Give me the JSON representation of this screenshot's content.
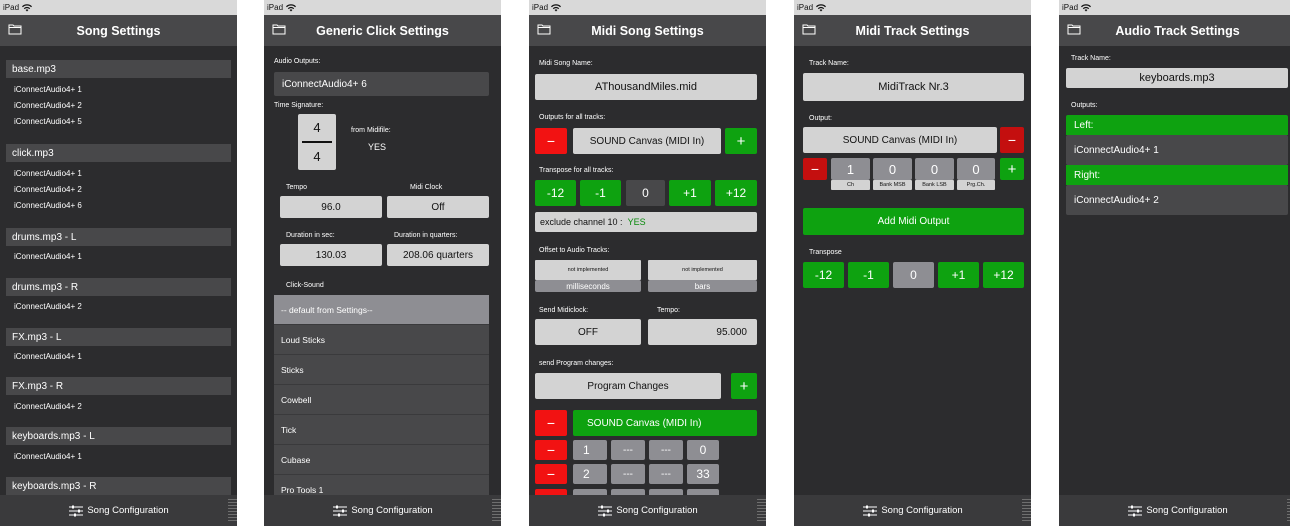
{
  "status": {
    "device": "iPad"
  },
  "tabbar_label": "Song Configuration",
  "screen1": {
    "title": "Song Settings",
    "files": [
      {
        "name": "base.mp3",
        "outputs": [
          "iConnectAudio4+ 1",
          "iConnectAudio4+ 2",
          "iConnectAudio4+ 5"
        ]
      },
      {
        "name": "click.mp3",
        "outputs": [
          "iConnectAudio4+ 1",
          "iConnectAudio4+ 2",
          "iConnectAudio4+ 6"
        ]
      },
      {
        "name": "drums.mp3 - L",
        "outputs": [
          "iConnectAudio4+ 1"
        ]
      },
      {
        "name": "drums.mp3 - R",
        "outputs": [
          "iConnectAudio4+ 2"
        ]
      },
      {
        "name": "FX.mp3 - L",
        "outputs": [
          "iConnectAudio4+ 1"
        ]
      },
      {
        "name": "FX.mp3 - R",
        "outputs": [
          "iConnectAudio4+ 2"
        ]
      },
      {
        "name": "keyboards.mp3 - L",
        "outputs": [
          "iConnectAudio4+ 1"
        ]
      },
      {
        "name": "keyboards.mp3 - R",
        "outputs": []
      }
    ]
  },
  "screen2": {
    "title": "Generic Click Settings",
    "audio_outputs_label": "Audio Outputs:",
    "audio_output": "iConnectAudio4+ 6",
    "time_sig_label": "Time Signature:",
    "ts_top": "4",
    "ts_bottom": "4",
    "from_midifile_label": "from Midifile:",
    "from_midifile_value": "YES",
    "tempo_label": "Tempo",
    "tempo_value": "96.0",
    "midi_clock_label": "Midi Clock",
    "midi_clock_value": "Off",
    "dur_sec_label": "Duration in sec:",
    "dur_sec_value": "130.03",
    "dur_q_label": "Duration in quarters:",
    "dur_q_value": "208.06 quarters",
    "click_sound_label": "Click-Sound",
    "sounds": [
      "-- default from Settings--",
      "Loud Sticks",
      "Sticks",
      "Cowbell",
      "Tick",
      "Cubase",
      "Pro Tools 1"
    ]
  },
  "screen3": {
    "title": "Midi Song Settings",
    "song_name_label": "Midi Song Name:",
    "song_name": "AThousandMiles.mid",
    "outputs_label": "Outputs for all tracks:",
    "output_device": "SOUND Canvas (MIDI In)",
    "minus": "−",
    "plus": "+",
    "transpose_label": "Transpose for all tracks:",
    "transpose": [
      "-12",
      "-1",
      "0",
      "+1",
      "+12"
    ],
    "exclude_label": "exclude channel 10 :",
    "exclude_value": "YES",
    "offset_label": "Offset to Audio Tracks:",
    "offset_ms_top": "not implemented",
    "offset_ms_bottom": "milliseconds",
    "offset_bars_top": "not implemented",
    "offset_bars_bottom": "bars",
    "send_midiclock_label": "Send Midiclock:",
    "send_midiclock_value": "OFF",
    "tempo_label": "Tempo:",
    "tempo_value": "95.000",
    "send_pc_label": "send Program changes:",
    "program_changes": "Program Changes",
    "pc_device": "SOUND Canvas (MIDI In)",
    "pc_rows": [
      {
        "ch": "1",
        "msb": "---",
        "lsb": "---",
        "pc": "0"
      },
      {
        "ch": "2",
        "msb": "---",
        "lsb": "---",
        "pc": "33"
      }
    ]
  },
  "screen4": {
    "title": "Midi Track Settings",
    "track_name_label": "Track Name:",
    "track_name": "MidiTrack Nr.3",
    "output_label": "Output:",
    "output_device": "SOUND Canvas (MIDI In)",
    "values": [
      "1",
      "0",
      "0",
      "0"
    ],
    "value_labels": [
      "Ch",
      "Bank MSB",
      "Bank LSB",
      "Prg.Ch."
    ],
    "add_output": "Add Midi Output",
    "transpose_label": "Transpose",
    "transpose": [
      "-12",
      "-1",
      "0",
      "+1",
      "+12"
    ]
  },
  "screen5": {
    "title": "Audio Track Settings",
    "track_name_label": "Track Name:",
    "track_name": "keyboards.mp3",
    "outputs_label": "Outputs:",
    "left_label": "Left:",
    "left_value": "iConnectAudio4+ 1",
    "right_label": "Right:",
    "right_value": "iConnectAudio4+ 2"
  },
  "colors": {
    "green": "#0ea210",
    "red": "#f21212",
    "panel": "#2c2c2e",
    "nav": "#48484a"
  }
}
